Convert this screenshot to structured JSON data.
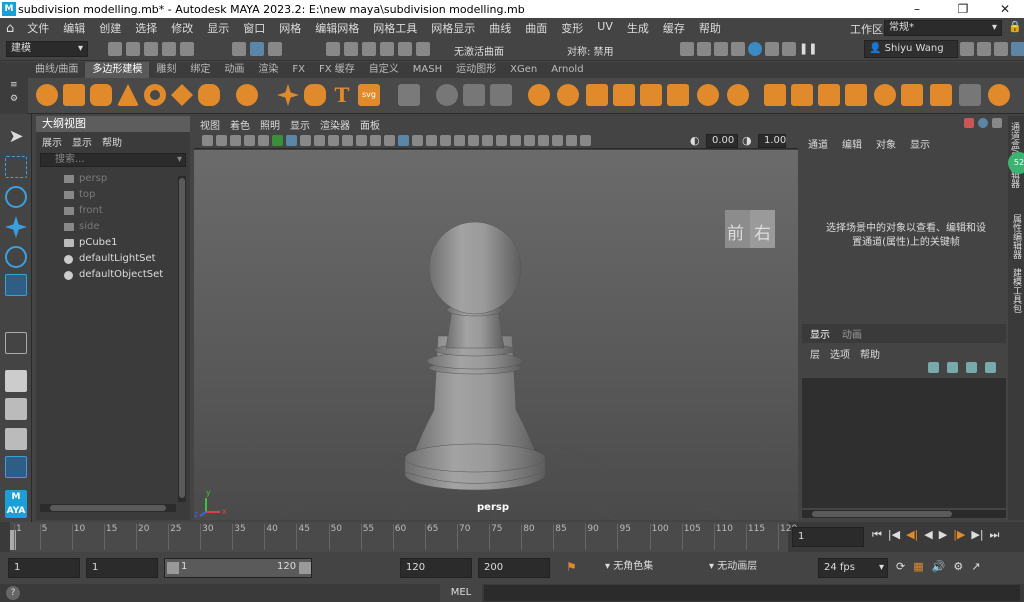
{
  "window": {
    "title": "subdivision modelling.mb* - Autodesk MAYA 2023.2: E:\\new maya\\subdivision modelling.mb",
    "logo": "M"
  },
  "menus": [
    "文件",
    "编辑",
    "创建",
    "选择",
    "修改",
    "显示",
    "窗口",
    "网格",
    "编辑网格",
    "网格工具",
    "网格显示",
    "曲线",
    "曲面",
    "变形",
    "UV",
    "生成",
    "缓存",
    "帮助"
  ],
  "workspace": {
    "label": "工作区:",
    "value": "常规*"
  },
  "status": {
    "mode": "建模",
    "no_live": "无激活曲面",
    "symmetry": "对称: 禁用",
    "user": "Shiyu Wang"
  },
  "shelf_tabs": [
    "曲线/曲面",
    "多边形建模",
    "雕刻",
    "绑定",
    "动画",
    "渲染",
    "FX",
    "FX 缓存",
    "自定义",
    "MASH",
    "运动图形",
    "XGen",
    "Arnold"
  ],
  "shelf_active": "多边形建模",
  "shelf_text_icons": {
    "text": "T",
    "svg": "svg"
  },
  "outliner": {
    "title": "大纲视图",
    "menu": [
      "展示",
      "显示",
      "帮助"
    ],
    "search_placeholder": "搜索...",
    "items": [
      {
        "label": "persp",
        "icon": "camera-icon",
        "dim": true
      },
      {
        "label": "top",
        "icon": "camera-icon",
        "dim": true
      },
      {
        "label": "front",
        "icon": "camera-icon",
        "dim": true
      },
      {
        "label": "side",
        "icon": "camera-icon",
        "dim": true
      },
      {
        "label": "pCube1",
        "icon": "mesh-icon",
        "dim": false
      },
      {
        "label": "defaultLightSet",
        "icon": "set-icon",
        "dim": false
      },
      {
        "label": "defaultObjectSet",
        "icon": "set-icon",
        "dim": false
      }
    ]
  },
  "viewport": {
    "menu": [
      "视图",
      "着色",
      "照明",
      "显示",
      "渲染器",
      "面板"
    ],
    "field1": "0.00",
    "field2": "1.00",
    "camera_label": "persp",
    "viewcube": {
      "front": "前",
      "right": "右"
    },
    "axis": {
      "x": "x",
      "y": "y",
      "z": "z"
    }
  },
  "channel_box": {
    "menu": [
      "通道",
      "编辑",
      "对象",
      "显示"
    ],
    "message": "选择场景中的对象以查看、编辑和设置通道(属性)上的关键帧"
  },
  "layer_editor": {
    "tabs": [
      "显示",
      "动画"
    ],
    "menu": [
      "层",
      "选项",
      "帮助"
    ]
  },
  "right_strip": [
    "通道盒/层编辑器",
    "属性编辑器",
    "建模工具包"
  ],
  "notification_badge": "52",
  "timeline": {
    "ticks": [
      1,
      5,
      10,
      15,
      20,
      25,
      30,
      35,
      40,
      45,
      50,
      55,
      60,
      65,
      70,
      75,
      80,
      85,
      90,
      95,
      100,
      105,
      110,
      115,
      120
    ],
    "current_frame": "1"
  },
  "range": {
    "start": "1",
    "playback_start": "1",
    "slider_start": "1",
    "slider_end": "120",
    "playback_end": "120",
    "end": "200",
    "character_set": "无角色集",
    "anim_layer": "无动画层",
    "fps": "24 fps"
  },
  "cmdline": {
    "lang": "MEL"
  },
  "colors": {
    "accent": "#1a9fd6",
    "shelf_orange": "#e08a2c",
    "bg": "#444444"
  }
}
